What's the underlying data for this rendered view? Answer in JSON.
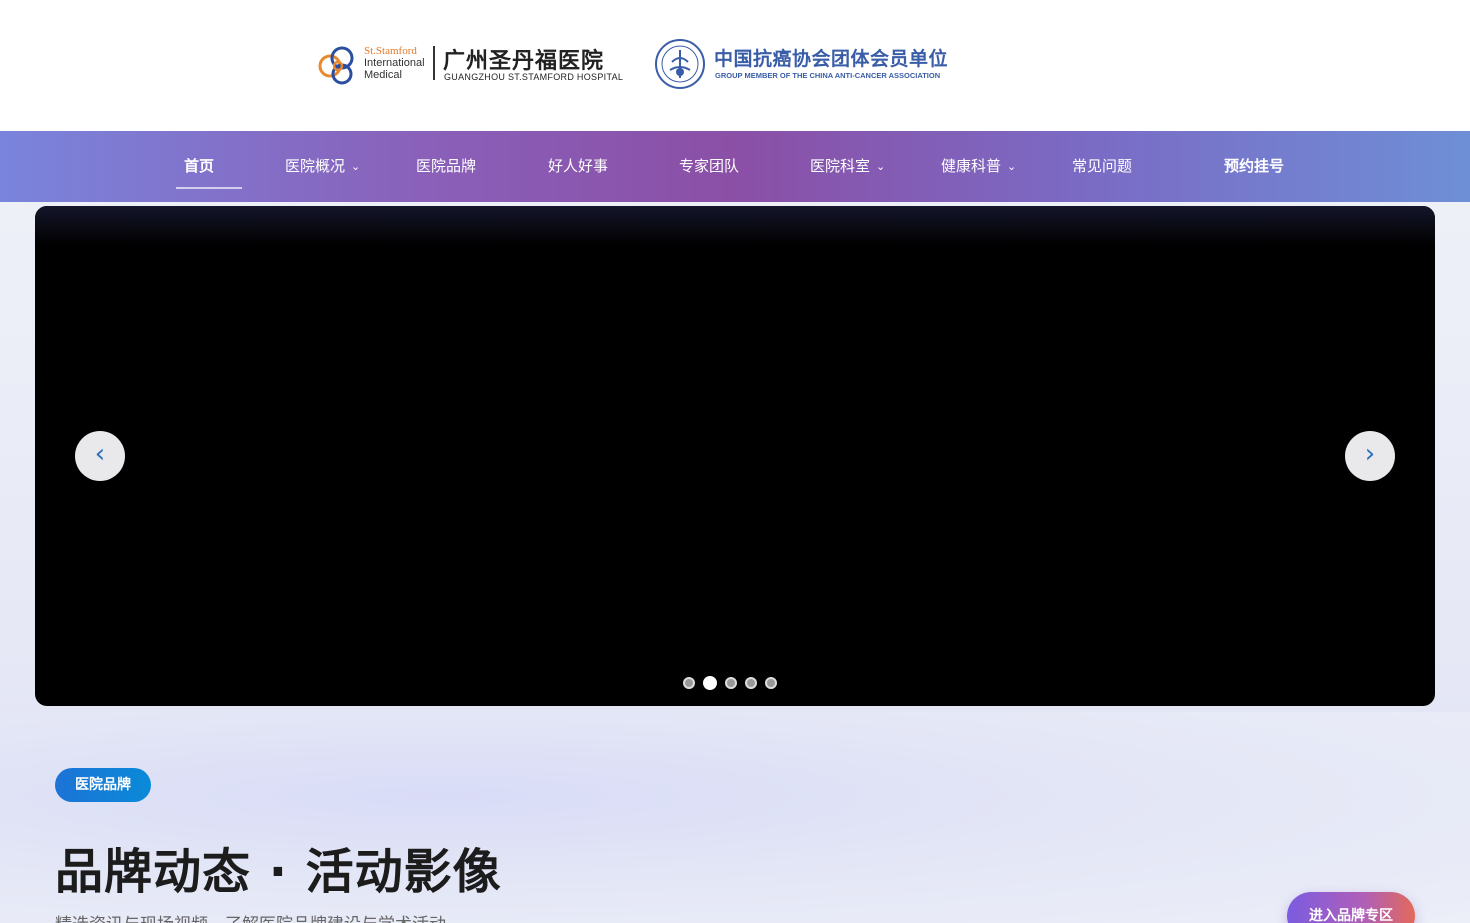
{
  "header": {
    "logo_en_line1": "St.Stamford",
    "logo_en_line2": "International",
    "logo_en_line3": "Medical",
    "hospital_name_cn": "广州圣丹福医院",
    "hospital_name_en": "GUANGZHOU ST.STAMFORD HOSPITAL",
    "association_cn": "中国抗癌协会团体会员单位",
    "association_en": "GROUP MEMBER OF THE CHINA ANTI-CANCER ASSOCIATION"
  },
  "nav": {
    "items": [
      {
        "label": "首页",
        "active": true,
        "dropdown": false
      },
      {
        "label": "医院概况",
        "active": false,
        "dropdown": true
      },
      {
        "label": "医院品牌",
        "active": false,
        "dropdown": false
      },
      {
        "label": "好人好事",
        "active": false,
        "dropdown": false
      },
      {
        "label": "专家团队",
        "active": false,
        "dropdown": false
      },
      {
        "label": "医院科室",
        "active": false,
        "dropdown": true
      },
      {
        "label": "健康科普",
        "active": false,
        "dropdown": true
      },
      {
        "label": "常见问题",
        "active": false,
        "dropdown": false
      },
      {
        "label": "预约挂号",
        "active": false,
        "dropdown": false
      }
    ],
    "chevron_icon": "chevron-down-icon",
    "gradient_colors": [
      "#7a84dc",
      "#8b4fa6",
      "#6e8fd6"
    ]
  },
  "carousel": {
    "prev_icon": "‹",
    "next_icon": "›",
    "slide_count": 5,
    "active_slide": 2
  },
  "section": {
    "tag": "医院品牌",
    "headline": "品牌动态 · 活动影像",
    "subline": "精选资讯与现场视频，了解医院品牌建设与学术活动",
    "cta_button": "进入品牌专区",
    "accent_color": "#1c73d6"
  }
}
